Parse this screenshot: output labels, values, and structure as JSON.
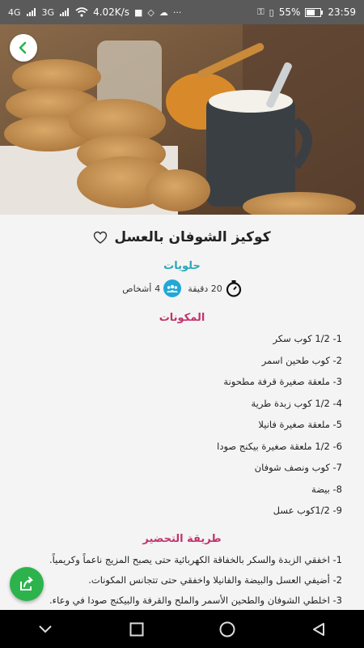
{
  "status_bar": {
    "network_left": "4G",
    "network_right": "3G",
    "speed": "4.02K/s",
    "battery": "55%",
    "time": "23:59"
  },
  "recipe": {
    "title": "كوكيز الشوفان بالعسل",
    "category": "حلويات",
    "time": "20 دقيقة",
    "servings": "4",
    "servings_label": "أشخاص"
  },
  "ingredients": {
    "heading": "المكونات",
    "items": [
      "1- 1/2 كوب سكر",
      "2- كوب طحين اسمر",
      "3- ملعقة صغيرة قرفة مطحونة",
      "4- 1/2 كوب زبدة طرية",
      "5- ملعقة صغيرة فانيلا",
      "6- 1/2 ملعقة صغيرة بيكنج صودا",
      "7- كوب ونصف شوفان",
      "8- بيضة",
      "9- 1/2كوب عسل"
    ]
  },
  "preparation": {
    "heading": "طريقة التحضير",
    "steps": [
      "1- اخفقي الزبدة والسكر بالخفاقة الكهربائية حتى يصبح المزيج ناعماً وكريمياً.",
      "2- أضيفي العسل والبيضة والفانيلا واخفقي حتى تتجانس المكونات.",
      "3- اخلطي الشوفان والطحين الأسمر والملح والقرفة والبيكنج صودا في وعاء."
    ]
  },
  "icons": {
    "back": "chevron-left-icon",
    "favorite": "heart-icon",
    "timer": "stopwatch-icon",
    "people": "people-icon",
    "share": "share-icon"
  },
  "colors": {
    "accent_green": "#2cb34b",
    "category_teal": "#2aa7b7",
    "section_pink": "#c2346b",
    "people_blue": "#22a7d6"
  }
}
